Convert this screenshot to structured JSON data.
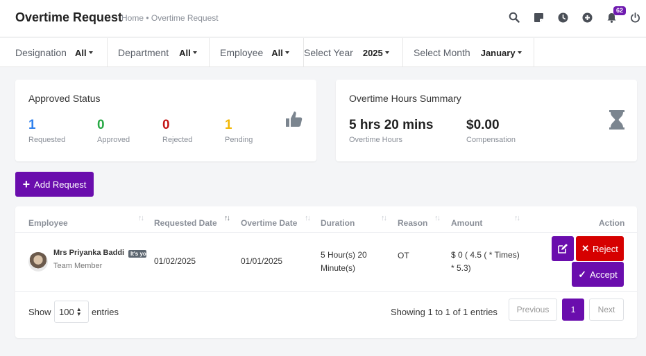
{
  "header": {
    "title": "Overtime Request",
    "breadcrumb": "Home • Overtime Request",
    "notification_count": "62",
    "icons": [
      "search-icon",
      "note-icon",
      "clock-icon",
      "plus-circle-icon",
      "bell-icon",
      "power-icon"
    ]
  },
  "filters": [
    {
      "label": "Designation",
      "value": "All"
    },
    {
      "label": "Department",
      "value": "All"
    },
    {
      "label": "Employee",
      "value": "All"
    },
    {
      "label": "Select Year",
      "value": "2025"
    },
    {
      "label": "Select Month",
      "value": "January"
    }
  ],
  "approved_status": {
    "title": "Approved Status",
    "stats": [
      {
        "value": "1",
        "label": "Requested",
        "color": "#2f80ed"
      },
      {
        "value": "0",
        "label": "Approved",
        "color": "#27a844"
      },
      {
        "value": "0",
        "label": "Rejected",
        "color": "#c41616"
      },
      {
        "value": "1",
        "label": "Pending",
        "color": "#f2b705"
      }
    ]
  },
  "hours_summary": {
    "title": "Overtime Hours Summary",
    "hours_value": "5 hrs 20 mins",
    "hours_label": "Overtime Hours",
    "comp_value": "$0.00",
    "comp_label": "Compensation"
  },
  "add_button": "Add Request",
  "table": {
    "columns": [
      "Employee",
      "Requested Date",
      "Overtime Date",
      "Duration",
      "Reason",
      "Amount",
      "Action"
    ],
    "rows": [
      {
        "name": "Mrs Priyanka Baddi",
        "tag": "It's you",
        "role": "Team Member",
        "requested_date": "01/02/2025",
        "overtime_date": "01/01/2025",
        "duration_line1": "5 Hour(s) 20",
        "duration_line2": "Minute(s)",
        "reason": "OT",
        "amount_line1": "$ 0 ( 4.5 ( * Times)",
        "amount_line2": "* 5.3)",
        "reject_label": "Reject",
        "accept_label": "Accept"
      }
    ]
  },
  "footer": {
    "show_label": "Show",
    "page_size": "100",
    "entries_label": "entries",
    "info": "Showing 1 to 1 of 1 entries",
    "prev": "Previous",
    "page": "1",
    "next": "Next"
  },
  "colors": {
    "primary": "#6a0dad",
    "danger": "#d60000"
  }
}
